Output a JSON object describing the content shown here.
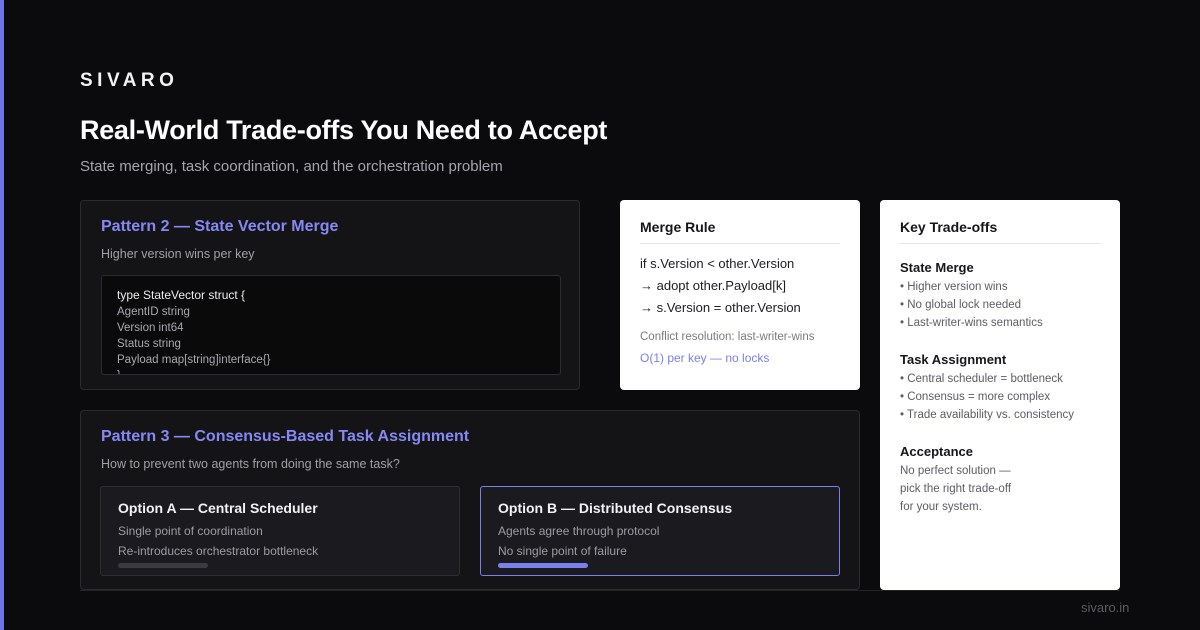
{
  "brand": "SIVARO",
  "title": "Real-World Trade-offs You Need to Accept",
  "subtitle": "State merging, task coordination, and the orchestration problem",
  "colors": {
    "accent": "#6f74e8",
    "accent_text": "#8589f5",
    "background": "#0b0b0d"
  },
  "pattern2": {
    "title": "Pattern 2 — State Vector Merge",
    "subtitle": "Higher version wins per key",
    "code": [
      "type StateVector struct {",
      "AgentID string",
      "Version int64",
      "Status string",
      "Payload map[string]interface{}",
      "}"
    ]
  },
  "merge_rule": {
    "title": "Merge Rule",
    "lines": [
      "if s.Version < other.Version",
      "→ adopt other.Payload[k]",
      "→ s.Version = other.Version"
    ],
    "note": "Conflict resolution: last-writer-wins",
    "highlight": "O(1) per key — no locks"
  },
  "pattern3": {
    "title": "Pattern 3 — Consensus-Based Task Assignment",
    "subtitle": "How to prevent two agents from doing the same task?",
    "option_a": {
      "title": "Option A — Central Scheduler",
      "line1": "Single point of coordination",
      "line2": "Re-introduces orchestrator bottleneck"
    },
    "option_b": {
      "title": "Option B — Distributed Consensus",
      "line1": "Agents agree through protocol",
      "line2": "No single point of failure"
    }
  },
  "tradeoffs": {
    "title": "Key Trade-offs",
    "state_merge": {
      "heading": "State Merge",
      "items": [
        "• Higher version wins",
        "• No global lock needed",
        "• Last-writer-wins semantics"
      ]
    },
    "task_assignment": {
      "heading": "Task Assignment",
      "items": [
        "• Central scheduler = bottleneck",
        "• Consensus = more complex",
        "• Trade availability vs. consistency"
      ]
    },
    "acceptance": {
      "heading": "Acceptance",
      "lines": [
        "No perfect solution —",
        "pick the right trade-off",
        "for your system."
      ]
    }
  },
  "footer": {
    "domain": "sivaro.in"
  }
}
